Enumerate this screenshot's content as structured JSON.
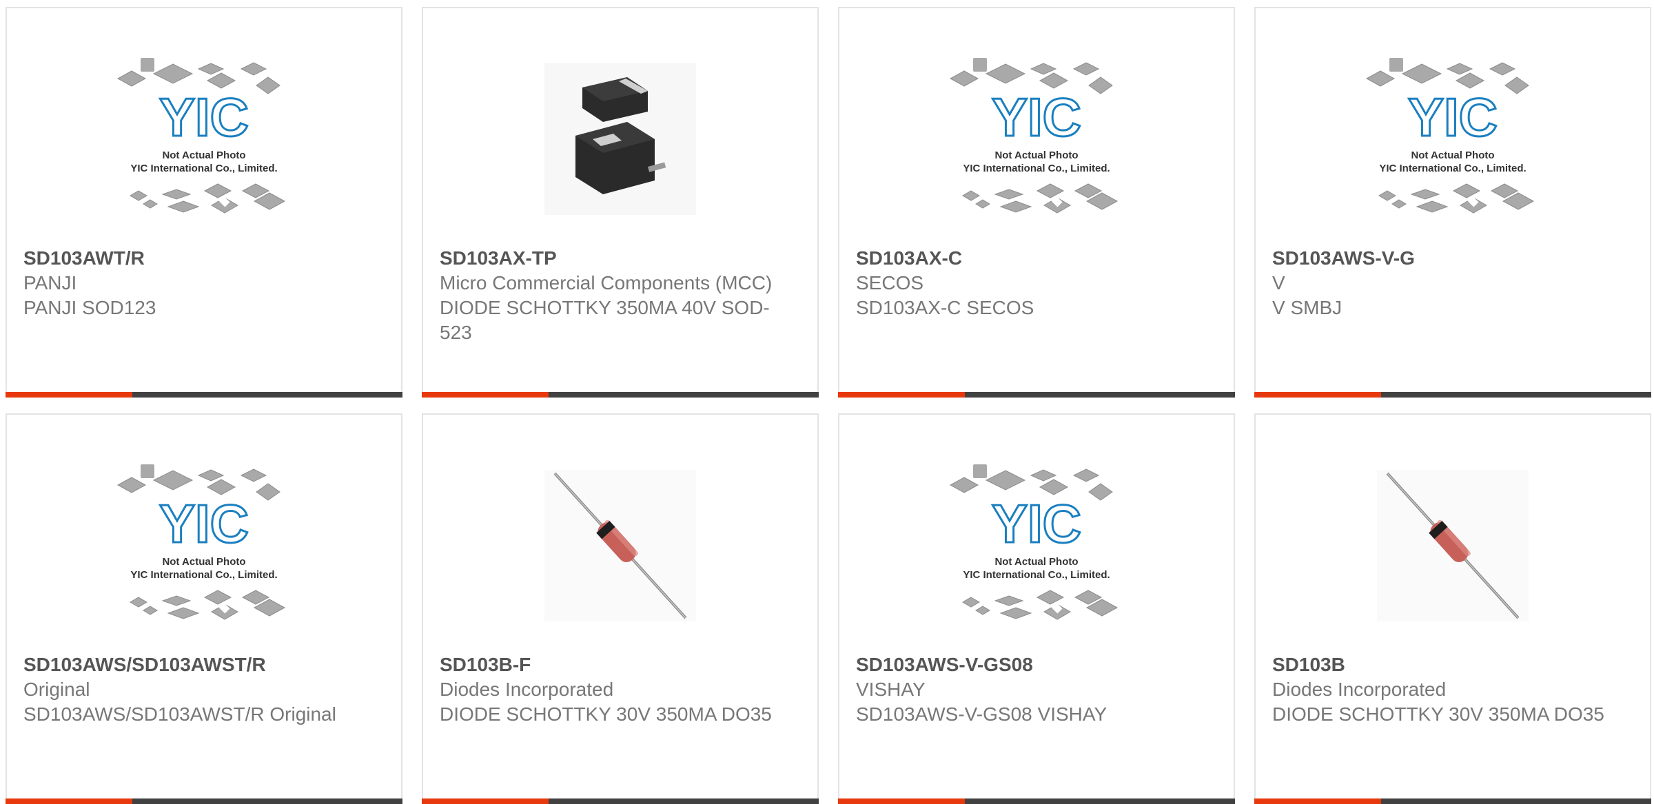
{
  "colors": {
    "accent": "#e8380d",
    "bar_dark": "#414141",
    "yic_blue": "#1a7fc0",
    "chip_gray": "#a9a9a9"
  },
  "placeholder": {
    "logo_text": "YIC",
    "line1": "Not Actual Photo",
    "line2": "YIC International Co., Limited."
  },
  "products": [
    {
      "part": "SD103AWT/R",
      "manufacturer": "PANJI",
      "description": "PANJI SOD123",
      "image": "placeholder"
    },
    {
      "part": "SD103AX-TP",
      "manufacturer": "Micro Commercial Components (MCC)",
      "description": "DIODE SCHOTTKY 350MA 40V SOD-523",
      "image": "smd-diode"
    },
    {
      "part": "SD103AX-C",
      "manufacturer": "SECOS",
      "description": "SD103AX-C SECOS",
      "image": "placeholder"
    },
    {
      "part": "SD103AWS-V-G",
      "manufacturer": "V",
      "description": "V SMBJ",
      "image": "placeholder"
    },
    {
      "part": "SD103AWS/SD103AWST/R",
      "manufacturer": "Original",
      "description": "SD103AWS/SD103AWST/R Original",
      "image": "placeholder"
    },
    {
      "part": "SD103B-F",
      "manufacturer": "Diodes Incorporated",
      "description": "DIODE SCHOTTKY 30V 350MA DO35",
      "image": "axial-diode"
    },
    {
      "part": "SD103AWS-V-GS08",
      "manufacturer": "VISHAY",
      "description": "SD103AWS-V-GS08 VISHAY",
      "image": "placeholder"
    },
    {
      "part": "SD103B",
      "manufacturer": "Diodes Incorporated",
      "description": "DIODE SCHOTTKY 30V 350MA DO35",
      "image": "axial-diode"
    }
  ]
}
